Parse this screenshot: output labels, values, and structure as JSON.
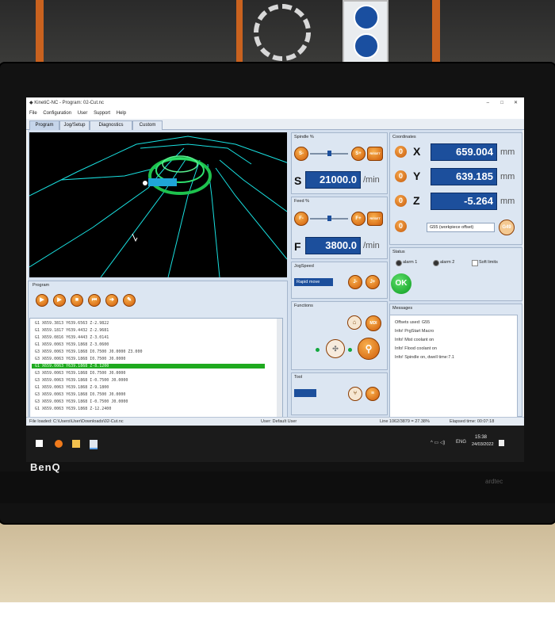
{
  "monitor": {
    "brand": "BenQ",
    "brand_right": "ardtec"
  },
  "window": {
    "title": "KinetiC-NC - Program: 02-Cut.nc",
    "controls": {
      "minimize": "–",
      "maximize": "□",
      "close": "✕"
    },
    "menu": [
      "File",
      "Configuration",
      "User",
      "Support",
      "Help"
    ],
    "tabs": [
      "Program",
      "Jog/Setup",
      "Diagnostics",
      "Custom"
    ],
    "active_tab": "Program"
  },
  "spindle": {
    "title": "Spindle %",
    "minus": "S-",
    "plus": "S+",
    "reset": "RESET",
    "label": "S",
    "value": "21000.0",
    "unit": "/min",
    "slider_level": 0.5
  },
  "feed": {
    "title": "Feed %",
    "minus": "F-",
    "plus": "F+",
    "reset": "RESET",
    "label": "F",
    "value": "3800.0",
    "unit": "/min",
    "slider_level": 0.5
  },
  "jog_speed": {
    "title": "JogSpeed",
    "mode": "Rapid move",
    "minus": "J-",
    "plus": "J+"
  },
  "functions": {
    "title": "Functions",
    "mdi": "MDI"
  },
  "tool": {
    "title": "Tool"
  },
  "coordinates": {
    "title": "Coordinates",
    "axes": [
      {
        "zero": "0",
        "label": "X",
        "value": "659.004",
        "unit": "mm"
      },
      {
        "zero": "0",
        "label": "Y",
        "value": "639.185",
        "unit": "mm"
      },
      {
        "zero": "0",
        "label": "Z",
        "value": "-5.264",
        "unit": "mm"
      }
    ],
    "offset_select": "G55 (workpiece offset)",
    "offset_button": "G49"
  },
  "status": {
    "title": "Status",
    "alarm1": "alarm 1",
    "alarm2": "alarm 2",
    "soft_limits": "Soft limits",
    "ok": "OK"
  },
  "messages": {
    "title": "Messages",
    "lines": [
      "Offsets used: G55",
      "Info! PrgStart Macro",
      "Info! Mist coolant on",
      "Info! Flood coolant on",
      "Info! Spindle on, dwell time:7.1"
    ]
  },
  "program": {
    "title": "Program",
    "lines": [
      "G1 X659.3813 Y639.6563 Z-2.9822",
      "G1 X659.1817 Y639.4432 Z-2.9681",
      "G1 X659.0816 Y639.4443 Z-3.0141",
      "G1 X659.0063 Y639.1868 Z-3.0600",
      "G3 X659.0063 Y639.1868 I0.7500 J0.0000 Z3.000",
      "G3 X659.0063 Y639.1868 I0.7500 J0.0000",
      "G1 X659.0063 Y639.1868 Z-8.1200",
      "G3 X659.0063 Y639.1868 I0.7500 J0.0000",
      "G3 X659.0063 Y639.1868 I-0.7500 J0.0000",
      "G1 X659.0063 Y639.1868 Z-9.1800",
      "G3 X659.0063 Y639.1868 I0.7500 J0.0000",
      "G3 X659.0063 Y639.1868 I-0.7500 J0.0000",
      "G1 X659.0063 Y639.1868 Z-12.2400"
    ],
    "selected_index": 6
  },
  "statusbar": {
    "file": "File loaded: C:\\Users\\User\\Downloads\\02-Cut.nc",
    "user": "User: Default User",
    "line": "Line 1062/3879 = 27.38%",
    "elapsed": "Elapsed time: 00:07:18"
  },
  "taskbar": {
    "time": "15:38",
    "date": "24/03/2022",
    "lang": "ENG"
  }
}
